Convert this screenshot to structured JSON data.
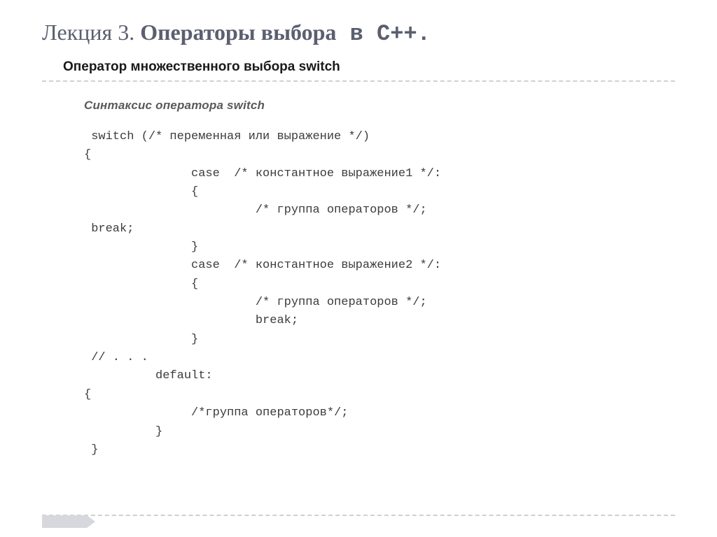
{
  "title": {
    "prefix": "Лекция 3. ",
    "bold": "Операторы выбора",
    "mono": " в С++."
  },
  "subtitle": "Оператор множественного выбора switch",
  "syntax_label": "Синтаксис оператора switch",
  "code": " switch (/* переменная или выражение */)\n{\n               case  /* константное выражение1 */:\n               {\n                        /* группа операторов */;\n break;\n               }\n               case  /* константное выражение2 */:\n               {\n                        /* группа операторов */;\n                        break;\n               }\n // . . .\n          default:\n{\n               /*группа операторов*/;\n          }\n }"
}
